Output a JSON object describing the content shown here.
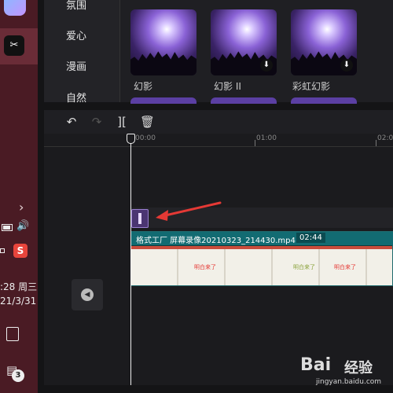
{
  "taskbar": {
    "capcut_icon": "capcut-logo",
    "chevron": "›",
    "sogou": "S",
    "time": ":28 周三",
    "date": "21/3/31",
    "badge": "3",
    "chat_glyph": "💬"
  },
  "library": {
    "categories": [
      "氛围",
      "爱心",
      "漫画",
      "自然"
    ],
    "items": [
      {
        "label": "幻影",
        "downloadable": false
      },
      {
        "label": "幻影 II",
        "downloadable": true
      },
      {
        "label": "彩虹幻影",
        "downloadable": true
      }
    ],
    "top_labels": [
      "",
      "",
      "",
      ""
    ]
  },
  "toolbar": {
    "undo": "↶",
    "redo": "↷",
    "split": "][",
    "delete": "🗑"
  },
  "ruler": {
    "marks": [
      "00:00",
      "01:00",
      "02:0"
    ]
  },
  "timeline": {
    "video_clip_name": "格式工厂 屏幕录像20210323_214430.mp4",
    "video_clip_duration": "02:44",
    "frame_texts": [
      "明白来了",
      "明白来了",
      "明白来了"
    ]
  },
  "watermark": {
    "brand": "Bai",
    "cn": "经验",
    "url": "jingyan.baidu.com"
  },
  "colors": {
    "accent_red": "#e53935",
    "clip_teal": "#126b72",
    "sticker_purple": "#4b3572"
  }
}
